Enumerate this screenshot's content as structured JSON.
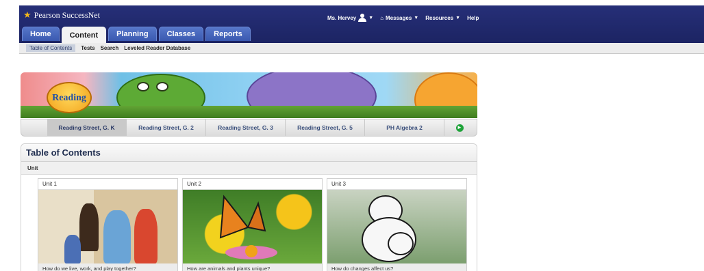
{
  "header": {
    "brand": "Pearson SuccessNet",
    "user": "Ms. Hervey",
    "messages": "Messages",
    "resources": "Resources",
    "help": "Help"
  },
  "main_tabs": [
    "Home",
    "Content",
    "Planning",
    "Classes",
    "Reports"
  ],
  "subnav": [
    "Table of Contents",
    "Tests",
    "Search",
    "Leveled Reader Database"
  ],
  "banner": {
    "logo_text": "Reading"
  },
  "books": [
    "Reading Street, G. K",
    "Reading Street, G. 2",
    "Reading Street, G. 3",
    "Reading Street, G. 5",
    "PH Algebra 2"
  ],
  "toc": {
    "title": "Table of Contents",
    "subheader": "Unit",
    "units": [
      {
        "label": "Unit 1",
        "question": "How do we live, work, and play together?"
      },
      {
        "label": "Unit 2",
        "question": "How are animals and plants unique?"
      },
      {
        "label": "Unit 3",
        "question": "How do changes affect us?"
      }
    ]
  },
  "colors": {
    "header_bg": "#1f2a6b",
    "tab_bg": "#3a59b0",
    "accent_green": "#1fa33a"
  }
}
